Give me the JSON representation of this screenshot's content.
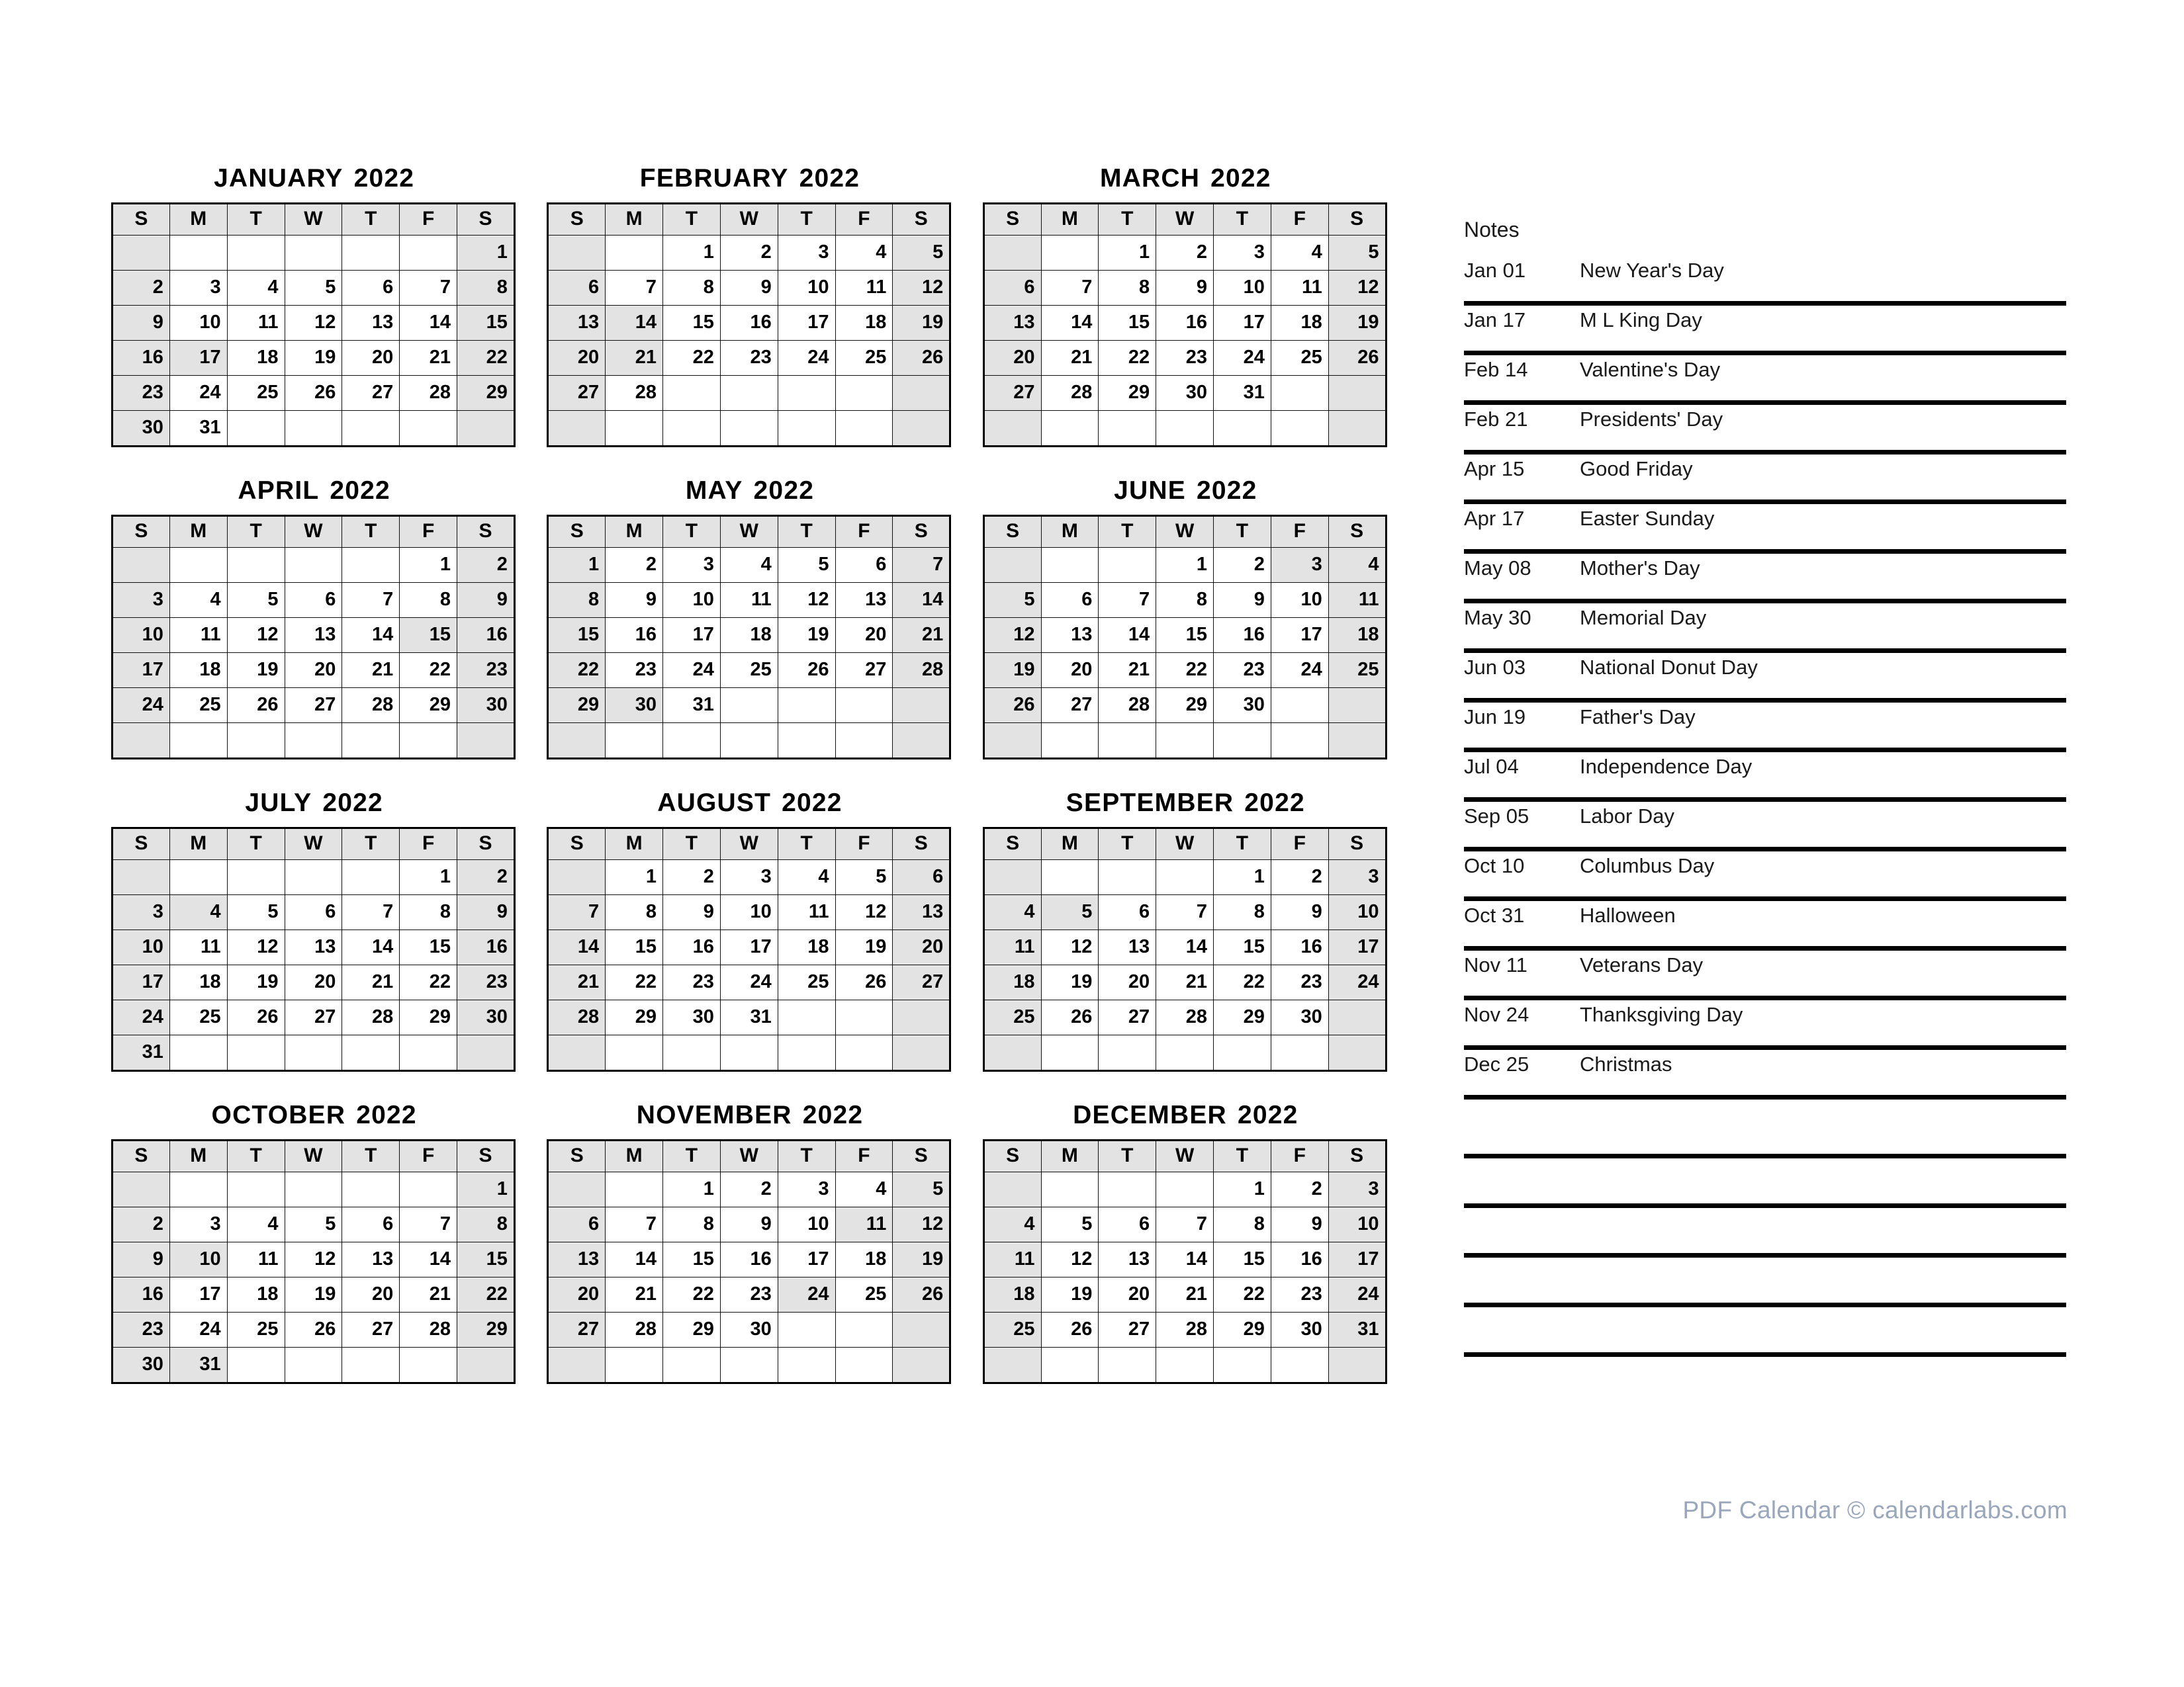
{
  "year": "2022",
  "weekday_headers": [
    "S",
    "M",
    "T",
    "W",
    "T",
    "F",
    "S"
  ],
  "colors": {
    "shade": "#e3e3e3",
    "grid_line": "#111111",
    "note_rule": "#000000",
    "footer_text": "#9aa7bb"
  },
  "months": [
    {
      "name": "JANUARY",
      "title": "JANUARY",
      "year": "2022",
      "weeks": [
        [
          "",
          "",
          "",
          "",
          "",
          "",
          "1"
        ],
        [
          "2",
          "3",
          "4",
          "5",
          "6",
          "7",
          "8"
        ],
        [
          "9",
          "10",
          "11",
          "12",
          "13",
          "14",
          "15"
        ],
        [
          "16",
          "17",
          "18",
          "19",
          "20",
          "21",
          "22"
        ],
        [
          "23",
          "24",
          "25",
          "26",
          "27",
          "28",
          "29"
        ],
        [
          "30",
          "31",
          "",
          "",
          "",
          "",
          ""
        ]
      ],
      "holidays": [
        "1",
        "17"
      ]
    },
    {
      "name": "FEBRUARY",
      "title": "FEBRUARY",
      "year": "2022",
      "weeks": [
        [
          "",
          "",
          "1",
          "2",
          "3",
          "4",
          "5"
        ],
        [
          "6",
          "7",
          "8",
          "9",
          "10",
          "11",
          "12"
        ],
        [
          "13",
          "14",
          "15",
          "16",
          "17",
          "18",
          "19"
        ],
        [
          "20",
          "21",
          "22",
          "23",
          "24",
          "25",
          "26"
        ],
        [
          "27",
          "28",
          "",
          "",
          "",
          "",
          ""
        ],
        [
          "",
          "",
          "",
          "",
          "",
          "",
          ""
        ]
      ],
      "holidays": [
        "14",
        "21"
      ]
    },
    {
      "name": "MARCH",
      "title": "MARCH",
      "year": "2022",
      "weeks": [
        [
          "",
          "",
          "1",
          "2",
          "3",
          "4",
          "5"
        ],
        [
          "6",
          "7",
          "8",
          "9",
          "10",
          "11",
          "12"
        ],
        [
          "13",
          "14",
          "15",
          "16",
          "17",
          "18",
          "19"
        ],
        [
          "20",
          "21",
          "22",
          "23",
          "24",
          "25",
          "26"
        ],
        [
          "27",
          "28",
          "29",
          "30",
          "31",
          "",
          ""
        ],
        [
          "",
          "",
          "",
          "",
          "",
          "",
          ""
        ]
      ],
      "holidays": []
    },
    {
      "name": "APRIL",
      "title": "APRIL",
      "year": "2022",
      "weeks": [
        [
          "",
          "",
          "",
          "",
          "",
          "1",
          "2"
        ],
        [
          "3",
          "4",
          "5",
          "6",
          "7",
          "8",
          "9"
        ],
        [
          "10",
          "11",
          "12",
          "13",
          "14",
          "15",
          "16"
        ],
        [
          "17",
          "18",
          "19",
          "20",
          "21",
          "22",
          "23"
        ],
        [
          "24",
          "25",
          "26",
          "27",
          "28",
          "29",
          "30"
        ],
        [
          "",
          "",
          "",
          "",
          "",
          "",
          ""
        ]
      ],
      "holidays": [
        "15"
      ]
    },
    {
      "name": "MAY",
      "title": "MAY",
      "year": "2022",
      "weeks": [
        [
          "1",
          "2",
          "3",
          "4",
          "5",
          "6",
          "7"
        ],
        [
          "8",
          "9",
          "10",
          "11",
          "12",
          "13",
          "14"
        ],
        [
          "15",
          "16",
          "17",
          "18",
          "19",
          "20",
          "21"
        ],
        [
          "22",
          "23",
          "24",
          "25",
          "26",
          "27",
          "28"
        ],
        [
          "29",
          "30",
          "31",
          "",
          "",
          "",
          ""
        ],
        [
          "",
          "",
          "",
          "",
          "",
          "",
          ""
        ]
      ],
      "holidays": [
        "30"
      ]
    },
    {
      "name": "JUNE",
      "title": "JUNE",
      "year": "2022",
      "weeks": [
        [
          "",
          "",
          "",
          "1",
          "2",
          "3",
          "4"
        ],
        [
          "5",
          "6",
          "7",
          "8",
          "9",
          "10",
          "11"
        ],
        [
          "12",
          "13",
          "14",
          "15",
          "16",
          "17",
          "18"
        ],
        [
          "19",
          "20",
          "21",
          "22",
          "23",
          "24",
          "25"
        ],
        [
          "26",
          "27",
          "28",
          "29",
          "30",
          "",
          ""
        ],
        [
          "",
          "",
          "",
          "",
          "",
          "",
          ""
        ]
      ],
      "holidays": [
        "3"
      ]
    },
    {
      "name": "JULY",
      "title": "JULY",
      "year": "2022",
      "weeks": [
        [
          "",
          "",
          "",
          "",
          "",
          "1",
          "2"
        ],
        [
          "3",
          "4",
          "5",
          "6",
          "7",
          "8",
          "9"
        ],
        [
          "10",
          "11",
          "12",
          "13",
          "14",
          "15",
          "16"
        ],
        [
          "17",
          "18",
          "19",
          "20",
          "21",
          "22",
          "23"
        ],
        [
          "24",
          "25",
          "26",
          "27",
          "28",
          "29",
          "30"
        ],
        [
          "31",
          "",
          "",
          "",
          "",
          "",
          ""
        ]
      ],
      "holidays": [
        "4"
      ]
    },
    {
      "name": "AUGUST",
      "title": "AUGUST",
      "year": "2022",
      "weeks": [
        [
          "",
          "1",
          "2",
          "3",
          "4",
          "5",
          "6"
        ],
        [
          "7",
          "8",
          "9",
          "10",
          "11",
          "12",
          "13"
        ],
        [
          "14",
          "15",
          "16",
          "17",
          "18",
          "19",
          "20"
        ],
        [
          "21",
          "22",
          "23",
          "24",
          "25",
          "26",
          "27"
        ],
        [
          "28",
          "29",
          "30",
          "31",
          "",
          "",
          ""
        ],
        [
          "",
          "",
          "",
          "",
          "",
          "",
          ""
        ]
      ],
      "holidays": []
    },
    {
      "name": "SEPTEMBER",
      "title": "SEPTEMBER",
      "year": "2022",
      "weeks": [
        [
          "",
          "",
          "",
          "",
          "1",
          "2",
          "3"
        ],
        [
          "4",
          "5",
          "6",
          "7",
          "8",
          "9",
          "10"
        ],
        [
          "11",
          "12",
          "13",
          "14",
          "15",
          "16",
          "17"
        ],
        [
          "18",
          "19",
          "20",
          "21",
          "22",
          "23",
          "24"
        ],
        [
          "25",
          "26",
          "27",
          "28",
          "29",
          "30",
          ""
        ],
        [
          "",
          "",
          "",
          "",
          "",
          "",
          ""
        ]
      ],
      "holidays": [
        "5"
      ]
    },
    {
      "name": "OCTOBER",
      "title": "OCTOBER",
      "year": "2022",
      "weeks": [
        [
          "",
          "",
          "",
          "",
          "",
          "",
          "1"
        ],
        [
          "2",
          "3",
          "4",
          "5",
          "6",
          "7",
          "8"
        ],
        [
          "9",
          "10",
          "11",
          "12",
          "13",
          "14",
          "15"
        ],
        [
          "16",
          "17",
          "18",
          "19",
          "20",
          "21",
          "22"
        ],
        [
          "23",
          "24",
          "25",
          "26",
          "27",
          "28",
          "29"
        ],
        [
          "30",
          "31",
          "",
          "",
          "",
          "",
          ""
        ]
      ],
      "holidays": [
        "10",
        "31"
      ]
    },
    {
      "name": "NOVEMBER",
      "title": "NOVEMBER",
      "year": "2022",
      "weeks": [
        [
          "",
          "",
          "1",
          "2",
          "3",
          "4",
          "5"
        ],
        [
          "6",
          "7",
          "8",
          "9",
          "10",
          "11",
          "12"
        ],
        [
          "13",
          "14",
          "15",
          "16",
          "17",
          "18",
          "19"
        ],
        [
          "20",
          "21",
          "22",
          "23",
          "24",
          "25",
          "26"
        ],
        [
          "27",
          "28",
          "29",
          "30",
          "",
          "",
          ""
        ],
        [
          "",
          "",
          "",
          "",
          "",
          "",
          ""
        ]
      ],
      "holidays": [
        "11",
        "24"
      ]
    },
    {
      "name": "DECEMBER",
      "title": "DECEMBER",
      "year": "2022",
      "weeks": [
        [
          "",
          "",
          "",
          "",
          "1",
          "2",
          "3"
        ],
        [
          "4",
          "5",
          "6",
          "7",
          "8",
          "9",
          "10"
        ],
        [
          "11",
          "12",
          "13",
          "14",
          "15",
          "16",
          "17"
        ],
        [
          "18",
          "19",
          "20",
          "21",
          "22",
          "23",
          "24"
        ],
        [
          "25",
          "26",
          "27",
          "28",
          "29",
          "30",
          "31"
        ],
        [
          "",
          "",
          "",
          "",
          "",
          "",
          ""
        ]
      ],
      "holidays": [
        "25"
      ]
    }
  ],
  "notes": {
    "heading": "Notes",
    "entries": [
      {
        "date": "Jan 01",
        "label": "New Year's Day"
      },
      {
        "date": "Jan 17",
        "label": "M L King Day"
      },
      {
        "date": "Feb 14",
        "label": "Valentine's Day"
      },
      {
        "date": "Feb 21",
        "label": "Presidents' Day"
      },
      {
        "date": "Apr 15",
        "label": "Good Friday"
      },
      {
        "date": "Apr 17",
        "label": "Easter Sunday"
      },
      {
        "date": "May 08",
        "label": "Mother's Day"
      },
      {
        "date": "May 30",
        "label": "Memorial Day"
      },
      {
        "date": "Jun 03",
        "label": "National Donut Day"
      },
      {
        "date": "Jun 19",
        "label": "Father's Day"
      },
      {
        "date": "Jul 04",
        "label": "Independence Day"
      },
      {
        "date": "Sep 05",
        "label": "Labor Day"
      },
      {
        "date": "Oct 10",
        "label": "Columbus Day"
      },
      {
        "date": "Oct 31",
        "label": "Halloween"
      },
      {
        "date": "Nov 11",
        "label": "Veterans Day"
      },
      {
        "date": "Nov 24",
        "label": "Thanksgiving Day"
      },
      {
        "date": "Dec 25",
        "label": "Christmas"
      }
    ],
    "blank_lines": 5
  },
  "footer": {
    "text": "PDF Calendar © calendarlabs.com"
  }
}
